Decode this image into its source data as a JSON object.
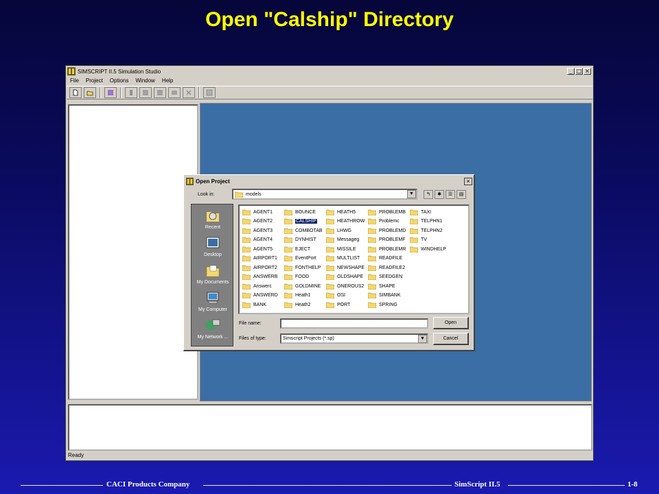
{
  "slide": {
    "title": "Open \"Calship\" Directory",
    "footer_left": "CACI Products Company",
    "footer_center": "SimScript II.5",
    "footer_right": "1-8"
  },
  "app": {
    "title": "SIMSCRIPT II.5 Simulation Studio",
    "window_buttons": [
      "_",
      "□",
      "×"
    ],
    "menu": [
      "File",
      "Project",
      "Options",
      "Window",
      "Help"
    ],
    "toolbar_icons": [
      "new-icon",
      "open-folder-icon",
      "project-icon",
      "build-icon",
      "compile-icon",
      "run-icon",
      "debug-icon",
      "stop-icon",
      "window-icon"
    ],
    "status": "Ready",
    "colors": {
      "mdi_background": "#3a6ea5",
      "chrome": "#d4d0c8"
    }
  },
  "dialog": {
    "title": "Open Project",
    "close": "×",
    "look_in_label": "Look in:",
    "look_in_value": "models",
    "places": [
      "Recent",
      "Desktop",
      "My Documents",
      "My Computer",
      "My Network ..."
    ],
    "columns": [
      [
        "AGENT1",
        "AGENT2",
        "AGENT3",
        "AGENT4",
        "AGENT5",
        "AIRPORT1",
        "AIRPORT2",
        "ANSWERB",
        "Answerc",
        "ANSWERD",
        "BANK"
      ],
      [
        "BOUNCE",
        "CALSHIP",
        "COMBOTAB",
        "DYNHIST",
        "EJECT",
        "EventPort",
        "FONTHELP",
        "FOOD",
        "GOLDMINE",
        "Heath1",
        "Heath2"
      ],
      [
        "HEATH5",
        "HEATHROW",
        "LHWG",
        "Messageg",
        "MISSILE",
        "MULTLIST",
        "NEWSHAPE",
        "OLDSHAPE",
        "ONEROUS2",
        "OSI",
        "PORT"
      ],
      [
        "PROBLEMB",
        "Problemc",
        "PROBLEMD",
        "PROBLEMF",
        "PROBLEMR",
        "READFILE",
        "READFILE2",
        "SEEDGEN",
        "SHAPE",
        "SIMBANK",
        "SPRING"
      ],
      [
        "TAXI",
        "TELPHN1",
        "TELPHN2",
        "TV",
        "WINDHELP"
      ]
    ],
    "selected": "CALSHIP",
    "file_name_label": "File name:",
    "file_name_value": "",
    "files_of_type_label": "Files of type:",
    "files_of_type_value": "Simscript Projects (*.sp)",
    "open_button": "Open",
    "cancel_button": "Cancel"
  }
}
